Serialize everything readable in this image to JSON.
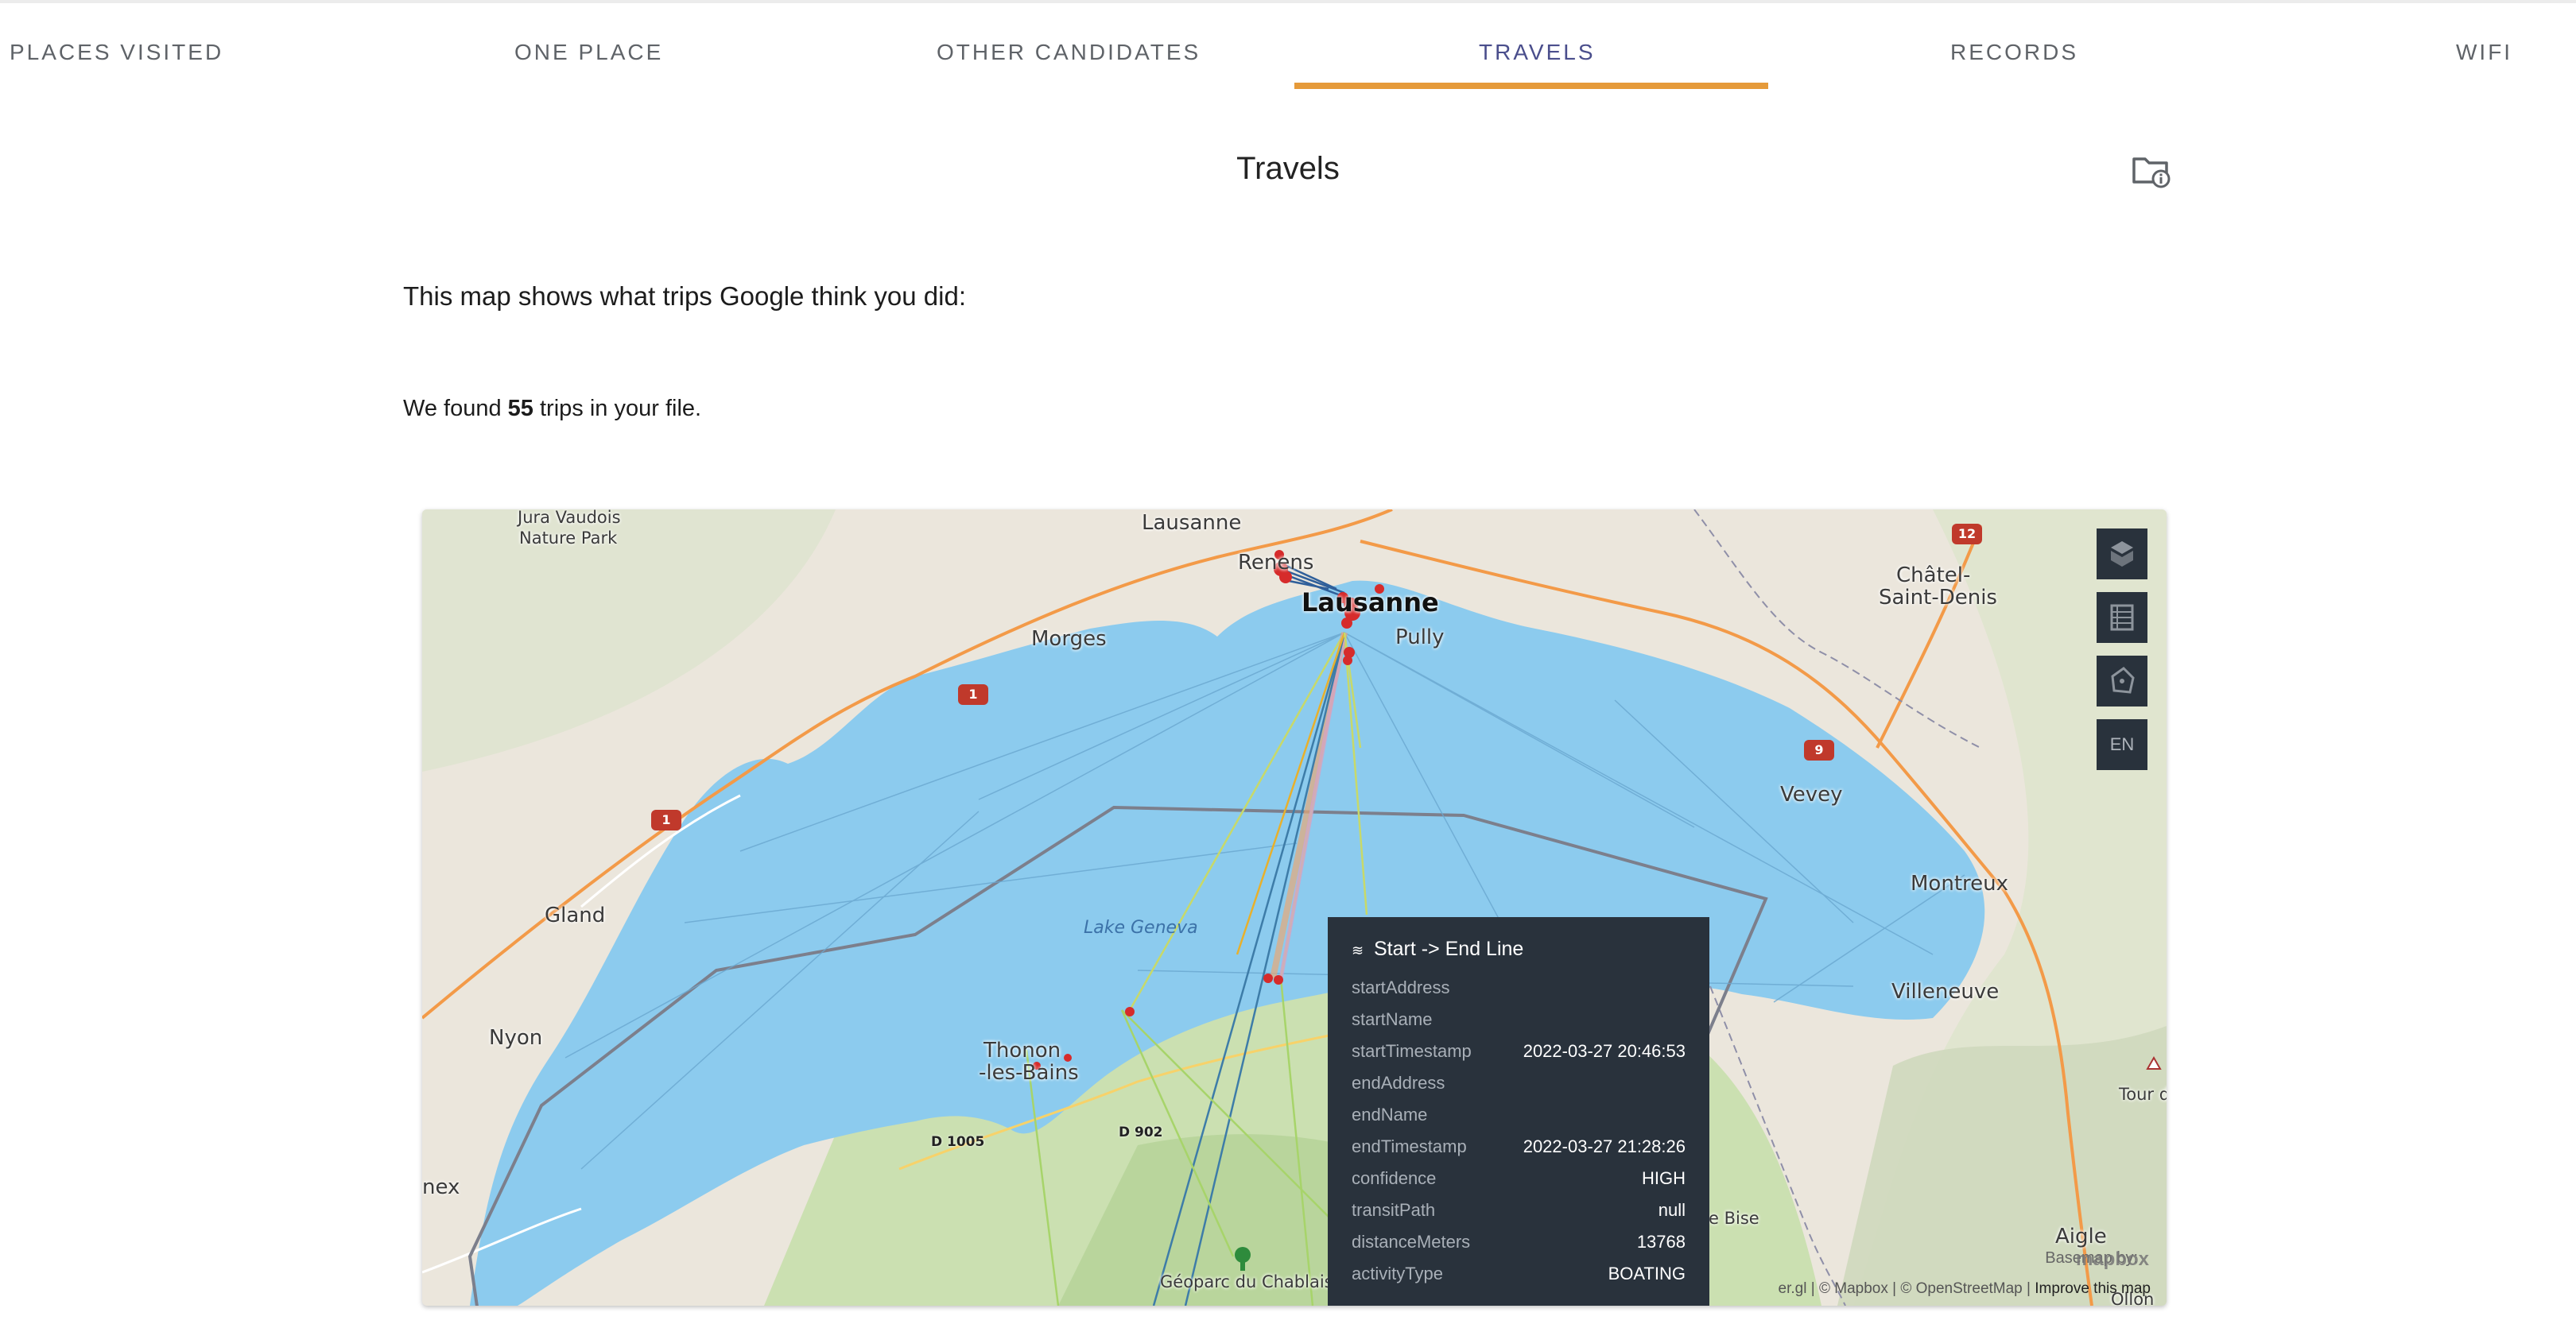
{
  "tabs": [
    {
      "label": "PLACES VISITED"
    },
    {
      "label": "ONE PLACE"
    },
    {
      "label": "OTHER CANDIDATES"
    },
    {
      "label": "TRAVELS"
    },
    {
      "label": "RECORDS"
    },
    {
      "label": "WIFI"
    }
  ],
  "active_tab": "TRAVELS",
  "accent_color": "#e59a3a",
  "header": {
    "title": "Travels",
    "info_icon": "folder-info-icon"
  },
  "intro_text": "This map shows what trips Google think you did:",
  "found": {
    "prefix": "We found",
    "count": "55",
    "suffix": "trips in your file."
  },
  "map": {
    "places": {
      "jura": "Jura Vaudois",
      "jura2": "Nature Park",
      "lausanne_top": "Lausanne",
      "renens": "Renens",
      "lausanne": "Lausanne",
      "morges": "Morges",
      "pully": "Pully",
      "chatel1": "Châtel-",
      "chatel2": "Saint-Denis",
      "vevey": "Vevey",
      "gland": "Gland",
      "nyon": "Nyon",
      "montreux": "Montreux",
      "villeneuve": "Villeneuve",
      "thonon1": "Thonon",
      "thonon2": "-les-Bains",
      "lake": "Lake Geneva",
      "nex": "nex",
      "tour": "Tour d",
      "aigle": "Aigle",
      "ollon": "Ollon",
      "bise": "e Bise",
      "geoparc": "Géoparc du Chablais"
    },
    "roads": {
      "d1005": "D 1005",
      "d902": "D 902"
    },
    "shields": {
      "a1a": "1",
      "a1b": "1",
      "a9": "9",
      "a12": "12"
    },
    "controls": {
      "layers_icon": "layers-icon",
      "legend_icon": "legend-icon",
      "draw_icon": "draw-polygon-icon",
      "lang": "EN"
    },
    "attribution": {
      "basemap": "Basemap by:",
      "mapbox_logo": "mapbox",
      "kepler": "er.gl",
      "mapbox": "© Mapbox",
      "osm": "© OpenStreetMap",
      "improve": "Improve this map"
    },
    "tooltip": {
      "title": "Start -> End Line",
      "rows": [
        {
          "key": "startAddress",
          "value": ""
        },
        {
          "key": "startName",
          "value": ""
        },
        {
          "key": "startTimestamp",
          "value": "2022-03-27 20:46:53"
        },
        {
          "key": "endAddress",
          "value": ""
        },
        {
          "key": "endName",
          "value": ""
        },
        {
          "key": "endTimestamp",
          "value": "2022-03-27 21:28:26"
        },
        {
          "key": "confidence",
          "value": "HIGH"
        },
        {
          "key": "transitPath",
          "value": "null"
        },
        {
          "key": "distanceMeters",
          "value": "13768"
        },
        {
          "key": "activityType",
          "value": "BOATING"
        }
      ]
    }
  }
}
